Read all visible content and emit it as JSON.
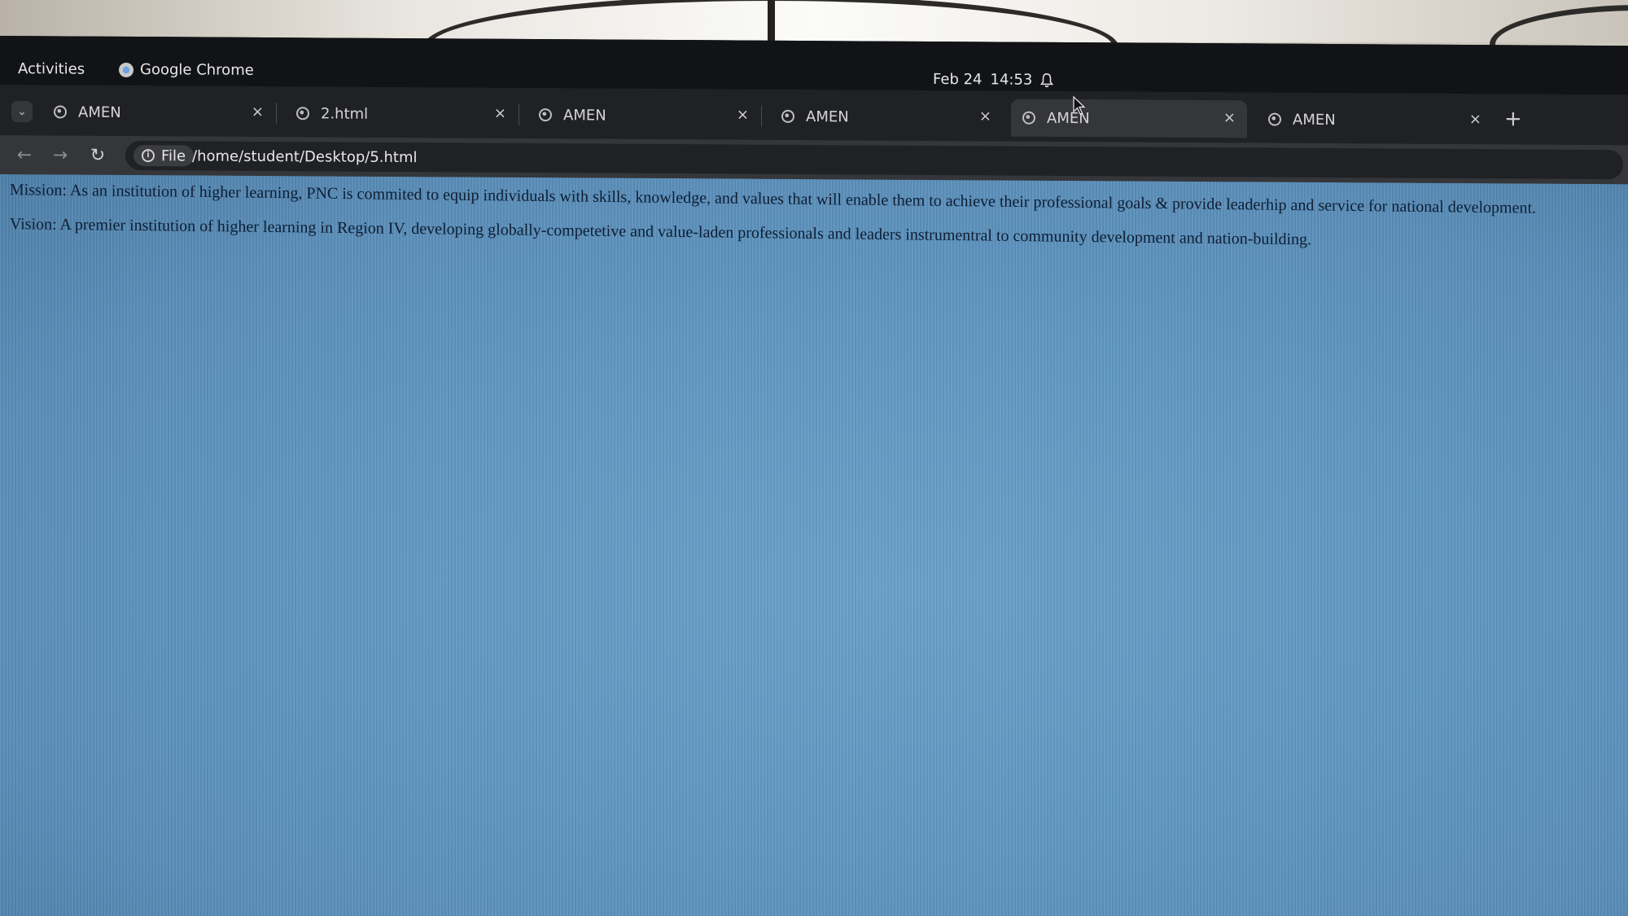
{
  "topbar": {
    "activities_label": "Activities",
    "app_name": "Google Chrome",
    "date": "Feb 24",
    "time": "14:53"
  },
  "tabs": [
    {
      "title": "AMEN",
      "active": false
    },
    {
      "title": "2.html",
      "active": false
    },
    {
      "title": "AMEN",
      "active": false
    },
    {
      "title": "AMEN",
      "active": false
    },
    {
      "title": "AMEN",
      "active": true
    },
    {
      "title": "AMEN",
      "active": false
    }
  ],
  "tab_close_glyph": "×",
  "new_tab_glyph": "+",
  "address_bar": {
    "scheme_label": "File",
    "url": "/home/student/Desktop/5.html"
  },
  "page": {
    "mission": "Mission: As an institution of higher learning, PNC is commited to equip individuals with skills, knowledge, and values that will enable them to achieve their professional goals & provide leaderhip and service for national development.",
    "vision": "Vision: A premier institution of higher learning in Region IV, developing globally-competetive and value-laden professionals and leaders instrumentral to community development and nation-building."
  },
  "colors": {
    "page_background": "#5f97c1",
    "text": "#0e1e34",
    "browser_chrome": "#202124"
  }
}
